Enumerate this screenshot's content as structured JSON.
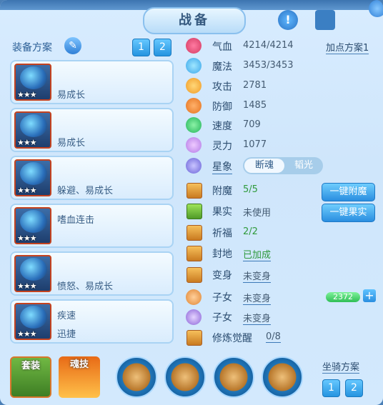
{
  "window": {
    "title": "战备"
  },
  "scheme": {
    "label": "装备方案",
    "pages": [
      "1",
      "2"
    ]
  },
  "equipment": [
    {
      "text": "易成长",
      "stars": "★★★"
    },
    {
      "text": "易成长",
      "stars": "★★★"
    },
    {
      "text": "躲避、易成长",
      "stars": "★★★"
    },
    {
      "text": "嗜血连击",
      "stars": "★★★"
    },
    {
      "text": "愤怒、易成长",
      "stars": "★★★"
    },
    {
      "text": "疾速",
      "text2": "迅捷",
      "stars": "★★★"
    }
  ],
  "stats": [
    {
      "label": "气血",
      "value": "4214/4214"
    },
    {
      "label": "魔法",
      "value": "3453/3453"
    },
    {
      "label": "攻击",
      "value": "2781"
    },
    {
      "label": "防御",
      "value": "1485"
    },
    {
      "label": "速度",
      "value": "709"
    },
    {
      "label": "灵力",
      "value": "1077"
    }
  ],
  "add_point_label": "加点方案1",
  "constellation": {
    "label": "星象",
    "on": "断魂",
    "off": "韬光"
  },
  "extras": [
    {
      "label": "附魔",
      "value": "5/5"
    },
    {
      "label": "果实",
      "value": "未使用"
    },
    {
      "label": "祈福",
      "value": "2/2"
    },
    {
      "label": "封地",
      "value": "已加成"
    },
    {
      "label": "变身",
      "value": "未变身"
    },
    {
      "label": "子女",
      "value": "未变身"
    },
    {
      "label": "子女",
      "value": "未变身"
    },
    {
      "label": "修炼觉醒",
      "value": "0/8"
    }
  ],
  "buttons": {
    "enchant": "一键附魔",
    "fruit": "一键果实"
  },
  "exp_value": "2372",
  "bottom": {
    "tab1": "套装",
    "tab2": "魂技"
  },
  "mount": {
    "label": "坐骑方案",
    "pages": [
      "1",
      "2"
    ]
  },
  "colors": {
    "accent": "#2a8ee0",
    "green": "#2f9a3b",
    "panel": "#d3e9fd"
  }
}
